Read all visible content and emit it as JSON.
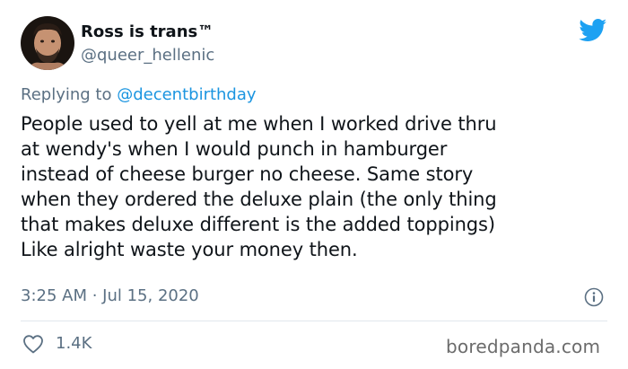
{
  "author": {
    "name": "Ross is trans™",
    "handle": "@queer_hellenic"
  },
  "reply": {
    "prefix": "Replying to ",
    "mention": "@decentbirthday"
  },
  "tweet": {
    "text": "People used to yell at me when I worked drive thru\nat wendy's when I would punch in hamburger\ninstead of cheese burger no cheese. Same story\nwhen they ordered the deluxe plain (the only thing\nthat makes deluxe different is the added toppings)\nLike alright waste your money then.",
    "timestamp": "3:25 AM · Jul 15, 2020",
    "likes": "1.4K"
  },
  "watermark": "boredpanda.com",
  "icons": {
    "brand": "twitter-bird-icon",
    "info": "info-icon",
    "like": "heart-icon"
  },
  "colors": {
    "twitter_blue": "#1da1f2",
    "secondary_text": "#5b7083",
    "mention": "#1b95e0"
  }
}
